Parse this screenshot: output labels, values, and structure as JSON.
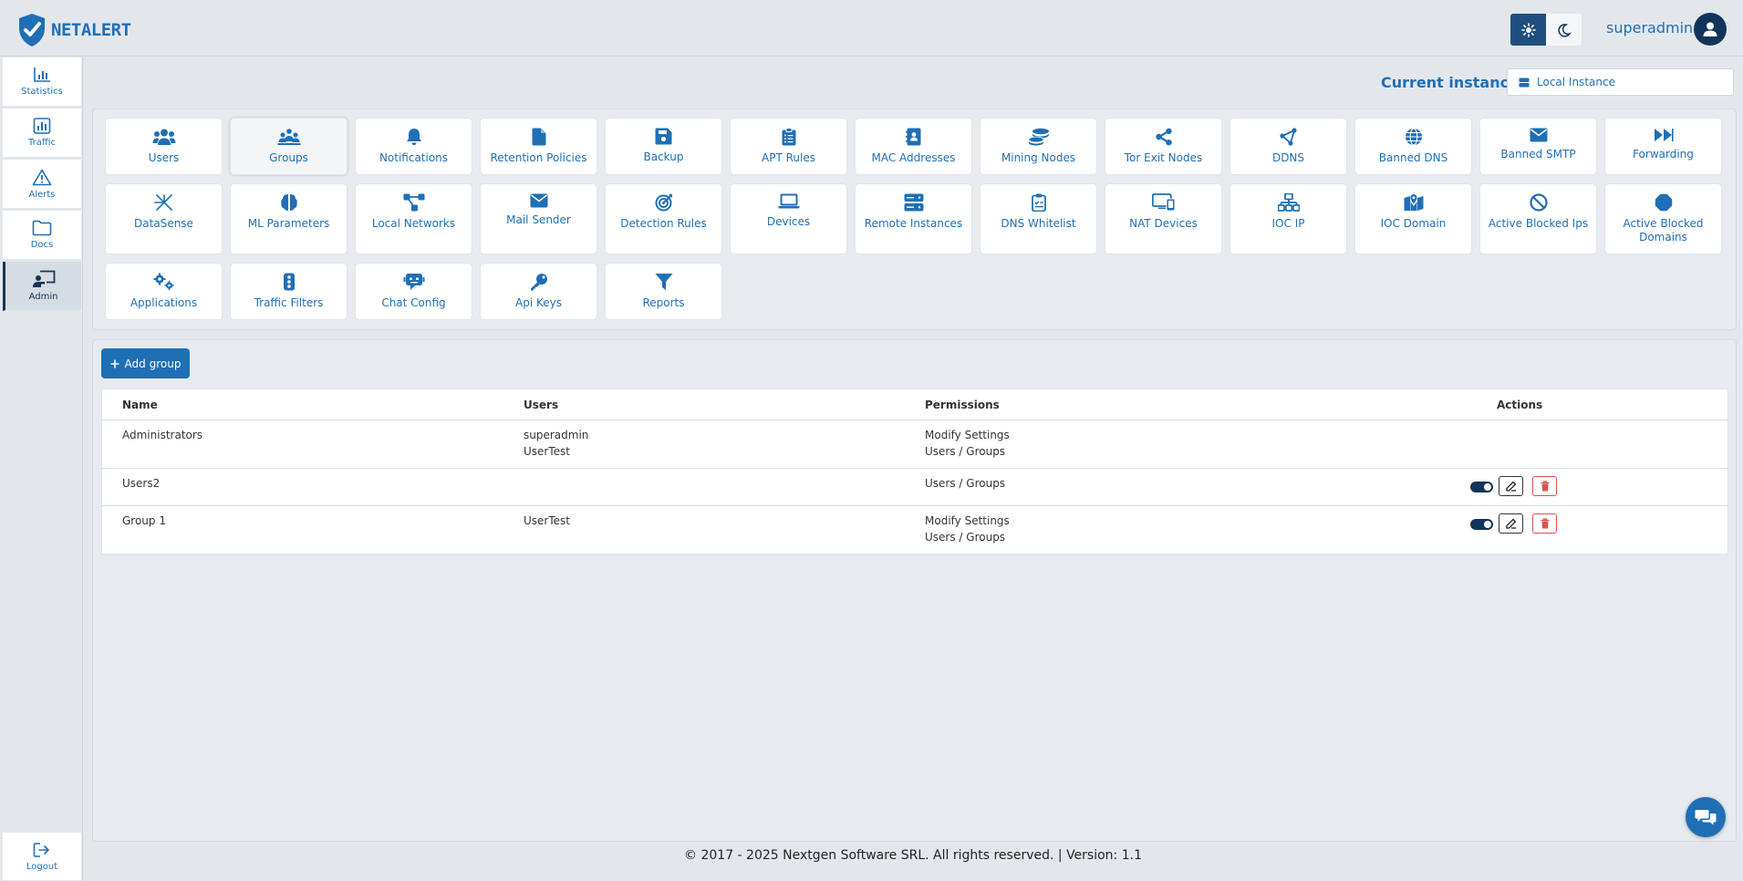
{
  "app": {
    "brand": "NETALERT"
  },
  "header": {
    "user_name": "superadmin"
  },
  "sidebar": {
    "items": [
      {
        "label": "Statistics",
        "icon": "chart-bar-icon"
      },
      {
        "label": "Traffic",
        "icon": "chart-square-icon"
      },
      {
        "label": "Alerts",
        "icon": "warning-icon"
      },
      {
        "label": "Docs",
        "icon": "folder-icon"
      },
      {
        "label": "Admin",
        "icon": "admin-icon",
        "active": true
      }
    ],
    "logout": "Logout"
  },
  "instance": {
    "label": "Current instance:",
    "value": "Local Instance"
  },
  "tiles": [
    "Users",
    "Groups",
    "Notifications",
    "Retention Policies",
    "Backup",
    "APT Rules",
    "MAC Addresses",
    "Mining Nodes",
    "Tor Exit Nodes",
    "DDNS",
    "Banned DNS",
    "Banned SMTP",
    "Forwarding",
    "DataSense",
    "ML Parameters",
    "Local Networks",
    "Mail Sender",
    "Detection Rules",
    "Devices",
    "Remote Instances",
    "DNS Whitelist",
    "NAT Devices",
    "IOC IP",
    "IOC Domain",
    "Active Blocked Ips",
    "Active Blocked Domains",
    "Applications",
    "Traffic Filters",
    "Chat Config",
    "Api Keys",
    "Reports"
  ],
  "groups": {
    "add_label": "Add group",
    "columns": {
      "name": "Name",
      "users": "Users",
      "permissions": "Permissions",
      "actions": "Actions"
    },
    "rows": [
      {
        "name": "Administrators",
        "users": [
          "superadmin",
          "UserTest"
        ],
        "permissions": [
          "Modify Settings",
          "Users / Groups"
        ],
        "actions": false
      },
      {
        "name": "Users2",
        "users": [],
        "permissions": [
          "Users / Groups"
        ],
        "actions": true,
        "enabled": true
      },
      {
        "name": "Group 1",
        "users": [
          "UserTest"
        ],
        "permissions": [
          "Modify Settings",
          "Users / Groups"
        ],
        "actions": true,
        "enabled": true
      }
    ]
  },
  "footer": {
    "text": "© 2017 - 2025 Nextgen Software SRL. All rights reserved. | Version: 1.1"
  },
  "colors": {
    "primary": "#1f6fb5",
    "dark": "#13345a",
    "danger": "#d9534f"
  }
}
